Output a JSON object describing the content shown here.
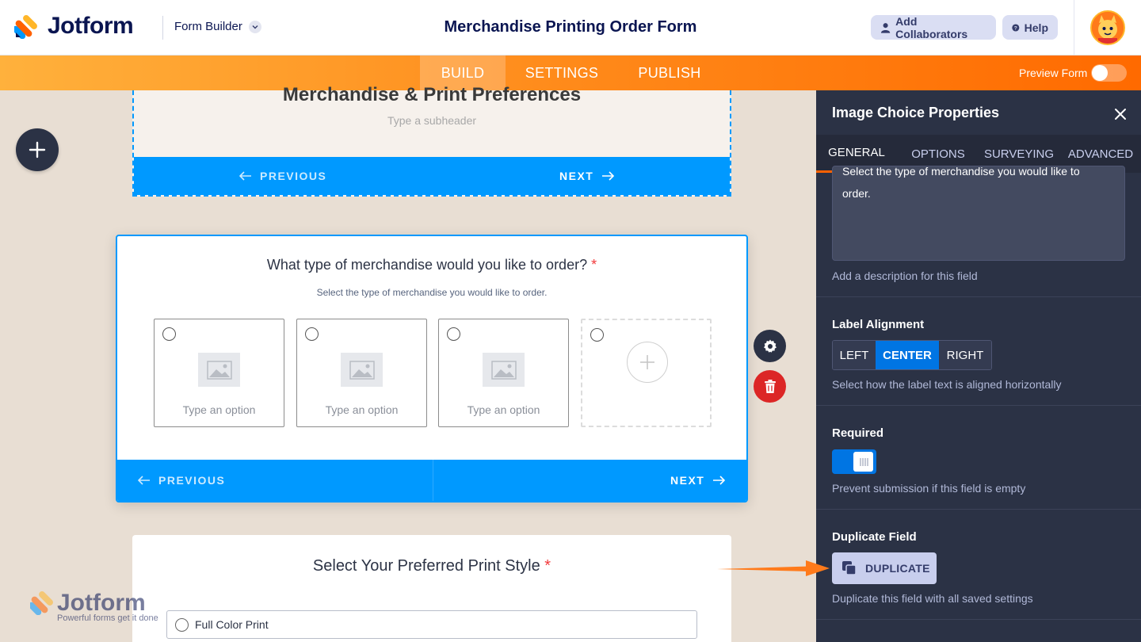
{
  "header": {
    "brand": "Jotform",
    "builder_mode": "Form Builder",
    "form_title": "Merchandise Printing Order Form",
    "add_collaborators": "Add Collaborators",
    "help": "Help"
  },
  "nav": {
    "tabs": [
      {
        "label": "BUILD",
        "active": true
      },
      {
        "label": "SETTINGS",
        "active": false
      },
      {
        "label": "PUBLISH",
        "active": false
      }
    ],
    "preview_label": "Preview Form",
    "preview_on": false
  },
  "canvas": {
    "header_card": {
      "heading": "Merchandise & Print Preferences",
      "subheader_placeholder": "Type a subheader",
      "prev": "PREVIOUS",
      "next": "NEXT"
    },
    "question_card": {
      "label": "What type of merchandise would you like to order?",
      "required_mark": "*",
      "description": "Select the type of merchandise you would like to order.",
      "options": [
        {
          "placeholder": "Type an option"
        },
        {
          "placeholder": "Type an option"
        },
        {
          "placeholder": "Type an option"
        }
      ],
      "prev": "PREVIOUS",
      "next": "NEXT"
    },
    "next_card": {
      "label": "Select Your Preferred Print Style",
      "required_mark": "*",
      "first_option": "Full Color Print"
    },
    "watermark": {
      "brand": "Jotform",
      "tagline": "Powerful forms get it done"
    }
  },
  "panel": {
    "title": "Image Choice Properties",
    "tabs": [
      "GENERAL",
      "OPTIONS",
      "SURVEYING",
      "ADVANCED"
    ],
    "active_tab": "GENERAL",
    "description_clipped": "Select the type of merchandise you would like to",
    "description_tail": "order.",
    "description_hint": "Add a description for this field",
    "label_alignment": {
      "title": "Label Alignment",
      "options": [
        "LEFT",
        "CENTER",
        "RIGHT"
      ],
      "selected": "CENTER",
      "hint": "Select how the label text is aligned horizontally"
    },
    "required": {
      "title": "Required",
      "on": true,
      "hint": "Prevent submission if this field is empty"
    },
    "duplicate": {
      "title": "Duplicate Field",
      "button": "DUPLICATE",
      "hint": "Duplicate this field with all saved settings"
    }
  },
  "colors": {
    "brand_navy": "#0a1551",
    "accent_orange": "#ff6100",
    "primary_blue": "#0099ff",
    "toggle_blue": "#0075e3",
    "panel_bg": "#2b3245",
    "danger_red": "#dc2626"
  }
}
